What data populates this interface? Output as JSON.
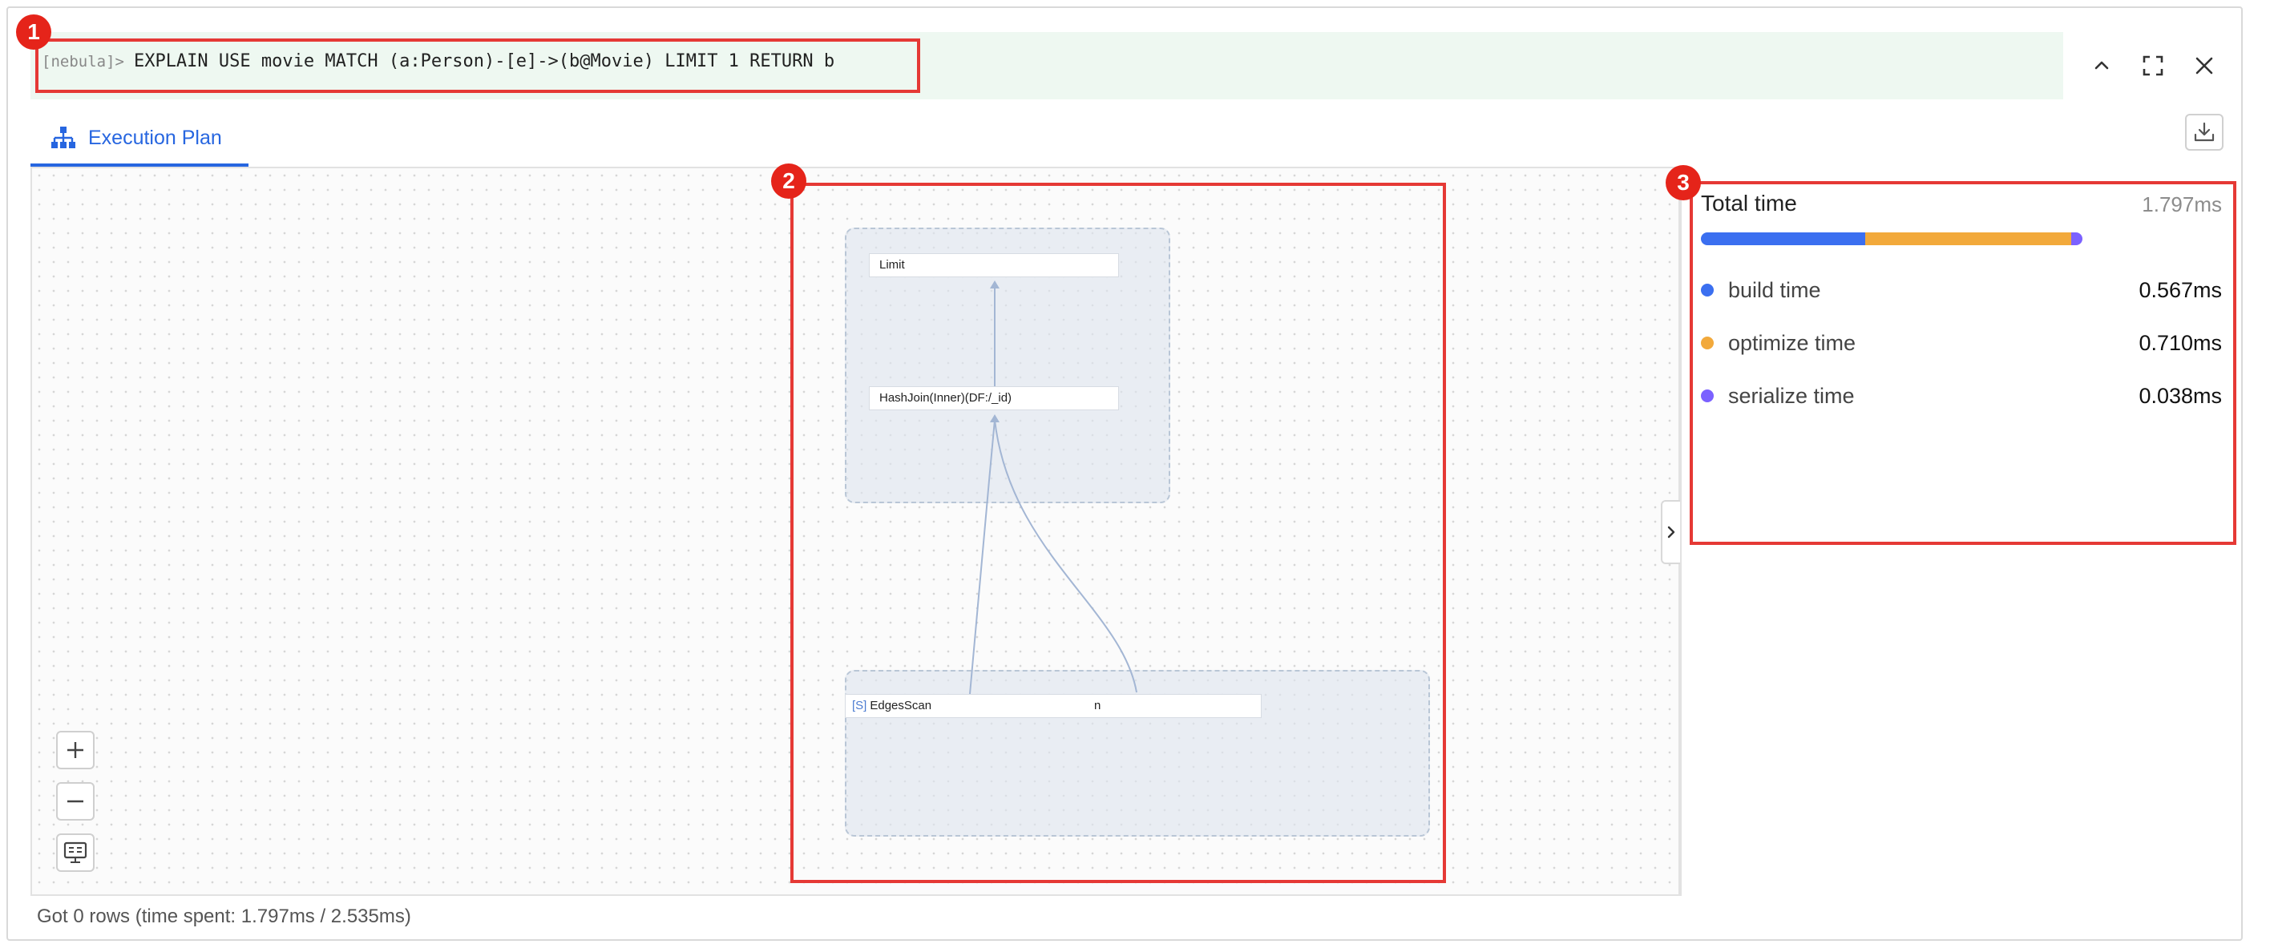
{
  "query": {
    "prompt": "[nebula]>",
    "text": "EXPLAIN USE movie MATCH (a:Person)-[e]->(b@Movie) LIMIT 1 RETURN b"
  },
  "badges": [
    "1",
    "2",
    "3"
  ],
  "tabs": [
    {
      "label": "Execution Plan",
      "icon": "hierarchy-icon"
    }
  ],
  "plan": {
    "nodes": [
      {
        "label": "Limit"
      },
      {
        "label": "HashJoin(Inner)(DF:/_id)"
      },
      {
        "tag": "[S]",
        "label": "EdgesScan"
      },
      {
        "label": "n"
      }
    ]
  },
  "stats": {
    "total_label": "Total time",
    "total_value": "1.797ms",
    "metrics": [
      {
        "label": "build time",
        "value": "0.567ms",
        "ms": 0.567,
        "color": "#3b6ff0"
      },
      {
        "label": "optimize time",
        "value": "0.710ms",
        "ms": 0.71,
        "color": "#f2a93b"
      },
      {
        "label": "serialize time",
        "value": "0.038ms",
        "ms": 0.038,
        "color": "#7b61ff"
      }
    ]
  },
  "footer": {
    "text": "Got 0 rows (time spent: 1.797ms / 2.535ms)"
  }
}
